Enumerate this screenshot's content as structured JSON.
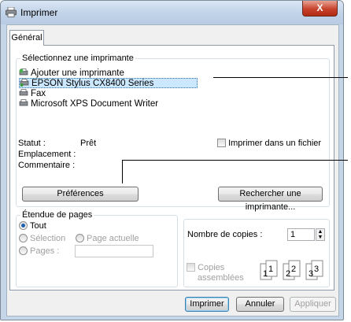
{
  "window": {
    "title": "Imprimer",
    "close_label": "X"
  },
  "tabs": [
    {
      "label": "Général"
    }
  ],
  "select_printer": {
    "legend": "Sélectionnez une imprimante",
    "printers": [
      {
        "label": "Ajouter une imprimante",
        "icon": "add-printer-icon"
      },
      {
        "label": "EPSON Stylus CX8400 Series",
        "icon": "printer-icon",
        "selected": true
      },
      {
        "label": "Fax",
        "icon": "fax-icon"
      },
      {
        "label": "Microsoft XPS Document Writer",
        "icon": "printer-icon"
      }
    ],
    "status_label": "Statut :",
    "status_value": "Prêt",
    "location_label": "Emplacement :",
    "comment_label": "Commentaire :",
    "print_to_file_label": "Imprimer dans un fichier",
    "preferences_label": "Préférences",
    "find_printer_label": "Rechercher une imprimante..."
  },
  "page_range": {
    "legend": "Étendue de pages",
    "all_label": "Tout",
    "selection_label": "Sélection",
    "current_page_label": "Page actuelle",
    "pages_label": "Pages :",
    "pages_value": ""
  },
  "copies": {
    "number_label": "Nombre de copies :",
    "number_value": "1",
    "collate_label_1": "Copies",
    "collate_label_2": "assemblées",
    "collate_pages": [
      "1",
      "1",
      "2",
      "2",
      "3",
      "3"
    ]
  },
  "footer": {
    "print_label": "Imprimer",
    "cancel_label": "Annuler",
    "apply_label": "Appliquer"
  },
  "colors": {
    "selection_highlight": "#cce8ff",
    "titlebar": "#c1d3e8",
    "close_button": "#c7432c"
  }
}
